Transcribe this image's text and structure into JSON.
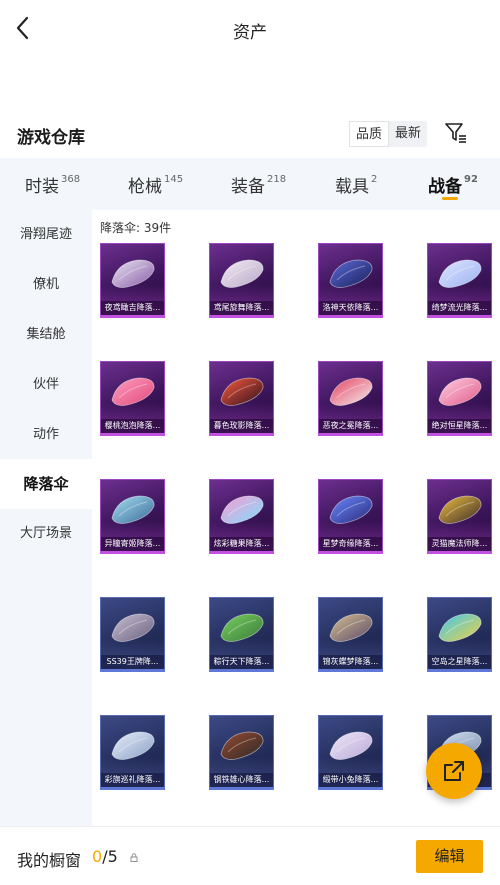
{
  "header": {
    "title": "资产"
  },
  "warehouse": {
    "title": "游戏仓库",
    "sort_options": [
      "品质",
      "最新"
    ]
  },
  "tabs": [
    {
      "label": "时装",
      "count": "368"
    },
    {
      "label": "枪械",
      "count": "145"
    },
    {
      "label": "装备",
      "count": "218"
    },
    {
      "label": "载具",
      "count": "2"
    },
    {
      "label": "战备",
      "count": "92"
    }
  ],
  "sidebar": {
    "items": [
      "滑翔尾迹",
      "僚机",
      "集结舱",
      "伙伴",
      "动作",
      "降落伞",
      "大厅场景"
    ]
  },
  "content": {
    "count_label": "降落伞: 39件",
    "items": [
      {
        "name": "夜鸢瞰吉降落...",
        "tier": "purple",
        "c1": "#e8e8f0",
        "c2": "#8a5aa8"
      },
      {
        "name": "鸢尾旋舞降落...",
        "tier": "purple",
        "c1": "#f2eef4",
        "c2": "#b9a6c8"
      },
      {
        "name": "洛神天依降落...",
        "tier": "purple",
        "c1": "#5b6bd8",
        "c2": "#1b1f5a"
      },
      {
        "name": "绮梦流光降落...",
        "tier": "purple",
        "c1": "#dfe6ff",
        "c2": "#9bb0f0"
      },
      {
        "name": "樱桃泡泡降落...",
        "tier": "purple",
        "c1": "#ff9ec0",
        "c2": "#e04a7a"
      },
      {
        "name": "暮色玫影降落...",
        "tier": "purple",
        "c1": "#ff5a3a",
        "c2": "#2a1020"
      },
      {
        "name": "恶夜之冕降落...",
        "tier": "purple",
        "c1": "#e84060",
        "c2": "#f0f0f0"
      },
      {
        "name": "绝对恒星降落...",
        "tier": "purple",
        "c1": "#ffd0e0",
        "c2": "#e05a8a"
      },
      {
        "name": "异瞳寄姬降落...",
        "tier": "purple",
        "c1": "#a8e0f0",
        "c2": "#3a6a9a"
      },
      {
        "name": "炫彩糖果降落...",
        "tier": "purple",
        "c1": "#ff9ad0",
        "c2": "#7adfff"
      },
      {
        "name": "星梦奇缘降落...",
        "tier": "purple",
        "c1": "#6a8aff",
        "c2": "#2a2a7a"
      },
      {
        "name": "灵猫魔法师降...",
        "tier": "purple",
        "c1": "#f0c040",
        "c2": "#3a2a2a"
      },
      {
        "name": "SS39王牌降...",
        "tier": "blue",
        "c1": "#c8c0d0",
        "c2": "#6a6080"
      },
      {
        "name": "粽行天下降落...",
        "tier": "blue",
        "c1": "#7ad060",
        "c2": "#3a7a3a"
      },
      {
        "name": "锦灰蝶梦降落...",
        "tier": "blue",
        "c1": "#d8c090",
        "c2": "#5a4a6a"
      },
      {
        "name": "空岛之星降落...",
        "tier": "blue",
        "c1": "#40c8f0",
        "c2": "#f0d040"
      },
      {
        "name": "彩旗巡礼降落...",
        "tier": "blue",
        "c1": "#e8eef8",
        "c2": "#8aa0c8"
      },
      {
        "name": "钢铁雄心降落...",
        "tier": "blue",
        "c1": "#9a4a30",
        "c2": "#2a2a2a"
      },
      {
        "name": "缎带小兔降落...",
        "tier": "blue",
        "c1": "#f0e8f8",
        "c2": "#b8a8d8"
      },
      {
        "name": "",
        "tier": "blue",
        "c1": "#d0e0f0",
        "c2": "#8090b0"
      }
    ]
  },
  "bottom": {
    "showcase_label": "我的橱窗",
    "showcase_current": "0",
    "showcase_total": "/5",
    "edit_label": "编辑"
  },
  "colors": {
    "accent": "#f5a800",
    "sidebar_bg": "#f3f6fa"
  }
}
